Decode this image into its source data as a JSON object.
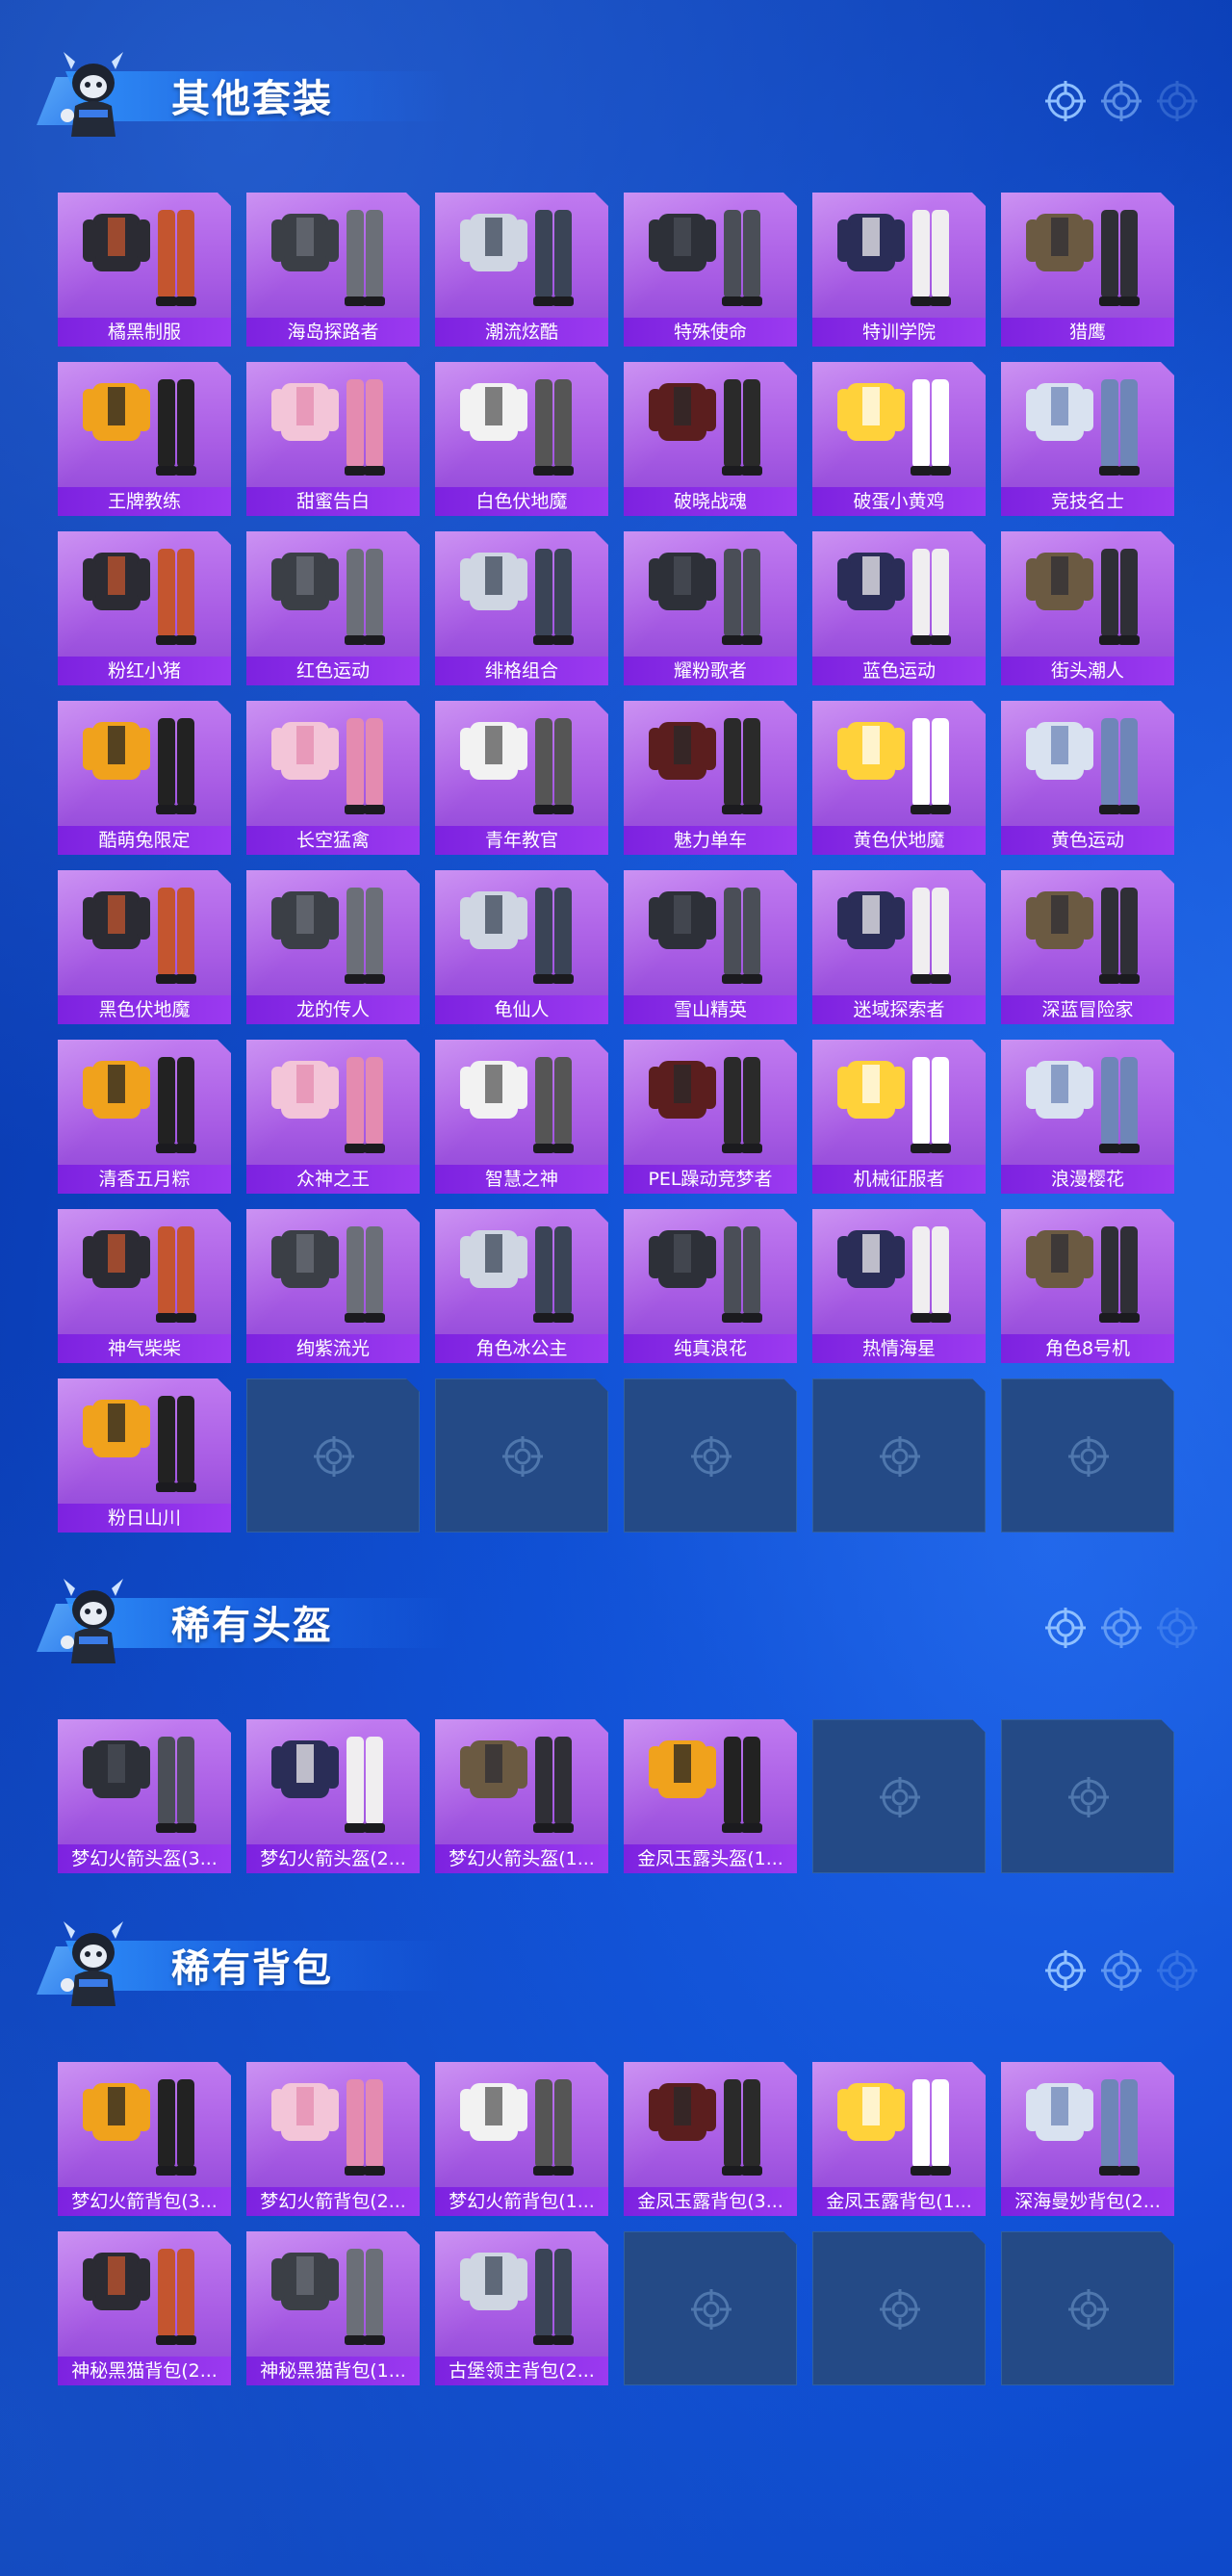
{
  "sections": [
    {
      "title": "其他套装",
      "items": [
        "橘黑制服",
        "海岛探路者",
        "潮流炫酷",
        "特殊使命",
        "特训学院",
        "猎鹰",
        "王牌教练",
        "甜蜜告白",
        "白色伏地魔",
        "破晓战魂",
        "破蛋小黄鸡",
        "竞技名士",
        "粉红小猪",
        "红色运动",
        "绯格组合",
        "耀粉歌者",
        "蓝色运动",
        "街头潮人",
        "酷萌兔限定",
        "长空猛禽",
        "青年教官",
        "魅力单车",
        "黄色伏地魔",
        "黄色运动",
        "黑色伏地魔",
        "龙的传人",
        "龟仙人",
        "雪山精英",
        "迷域探索者",
        "深蓝冒险家",
        "清香五月粽",
        "众神之王",
        "智慧之神",
        "PEL躁动竞梦者",
        "机械征服者",
        "浪漫樱花",
        "神气柴柴",
        "绚紫流光",
        "角色冰公主",
        "纯真浪花",
        "热情海星",
        "角色8号机",
        "粉日山川"
      ],
      "empty_slots": 5
    },
    {
      "title": "稀有头盔",
      "items": [
        "梦幻火箭头盔(3...",
        "梦幻火箭头盔(2...",
        "梦幻火箭头盔(1...",
        "金凤玉露头盔(1..."
      ],
      "empty_slots": 2
    },
    {
      "title": "稀有背包",
      "items": [
        "梦幻火箭背包(3...",
        "梦幻火箭背包(2...",
        "梦幻火箭背包(1...",
        "金凤玉露背包(3...",
        "金凤玉露背包(1...",
        "深海曼妙背包(2...",
        "神秘黑猫背包(2...",
        "神秘黑猫背包(1...",
        "古堡领主背包(2..."
      ],
      "empty_slots": 3
    }
  ],
  "icons": {
    "header_mascot": "mascot-icon",
    "target": "crosshair-icon",
    "empty": "crosshair-icon"
  },
  "colors": {
    "background": "#0f4fd4",
    "card_fill": "#b06ae8",
    "label_bar": "#8a2fe8",
    "empty_slot": "#244a86"
  }
}
